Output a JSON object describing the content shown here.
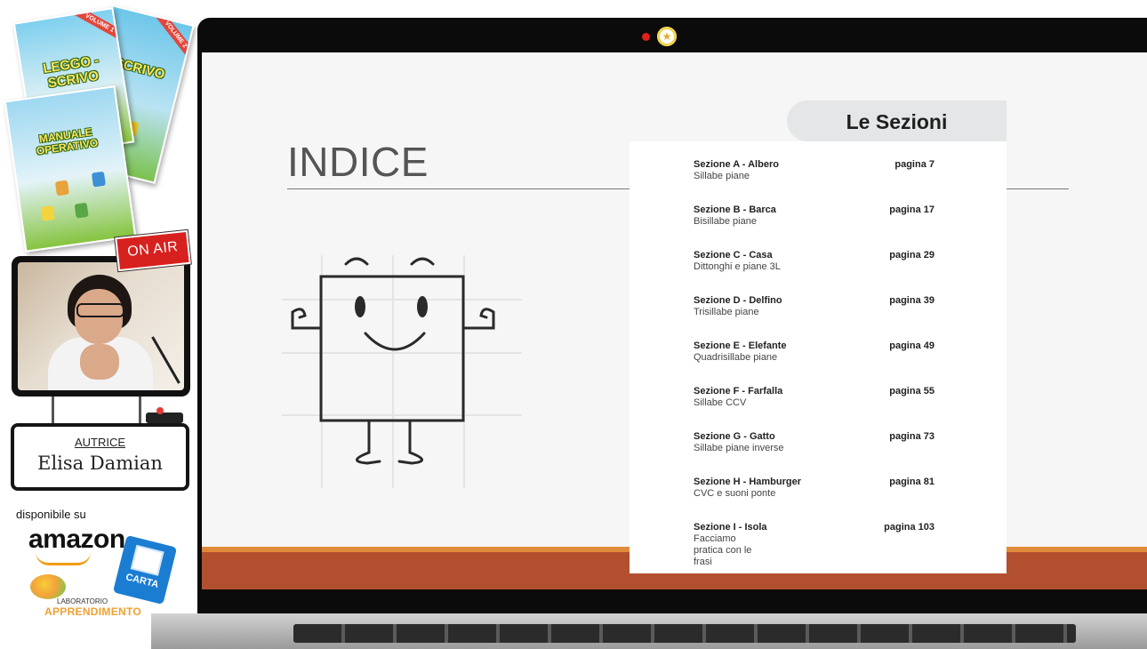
{
  "sidebar": {
    "books": [
      {
        "title": "LEGGO - SCRIVO",
        "ribbon": "VOLUME 1"
      },
      {
        "title": "SCRIVO",
        "ribbon": "VOLUME 2"
      },
      {
        "title": "MANUALE OPERATIVO"
      }
    ],
    "on_air": "ON AIR",
    "author_label": "AUTRICE",
    "author_name": "Elisa Damian",
    "available_on": "disponibile su",
    "amazon": "amazon",
    "carta": "CARTA",
    "lab_small": "LABORATORIO",
    "lab_big": "APPRENDIMENTO"
  },
  "slide": {
    "title": "INDICE",
    "sections_heading": "Le Sezioni",
    "entries": [
      {
        "name": "Sezione A - Albero",
        "subtitle": "Sillabe piane",
        "page": "pagina 7"
      },
      {
        "name": "Sezione B - Barca",
        "subtitle": "Bisillabe piane",
        "page": "pagina 17"
      },
      {
        "name": "Sezione C - Casa",
        "subtitle": "Dittonghi e piane 3L",
        "page": "pagina 29"
      },
      {
        "name": "Sezione D - Delfino",
        "subtitle": "Trisillabe piane",
        "page": "pagina 39"
      },
      {
        "name": "Sezione E - Elefante",
        "subtitle": "Quadrisillabe piane",
        "page": "pagina 49"
      },
      {
        "name": "Sezione F - Farfalla",
        "subtitle": "Sillabe CCV",
        "page": "pagina 55"
      },
      {
        "name": "Sezione G - Gatto",
        "subtitle": "Sillabe piane inverse",
        "page": "pagina 73"
      },
      {
        "name": "Sezione H - Hamburger",
        "subtitle": "CVC e suoni ponte",
        "page": "pagina 81"
      },
      {
        "name": "Sezione I - Isola",
        "subtitle": "Facciamo pratica con le frasi",
        "page": "pagina 103"
      }
    ]
  },
  "colors": {
    "footer_band": "#b24f2e",
    "footer_accent": "#e08a3a",
    "on_air": "#d7211f",
    "amazon_smile": "#f39c12"
  }
}
